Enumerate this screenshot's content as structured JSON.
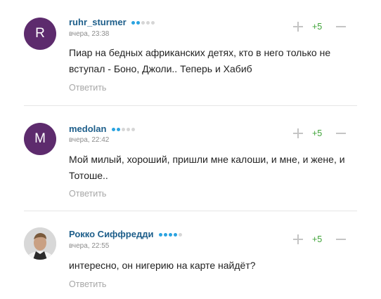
{
  "comments": [
    {
      "avatar_letter": "R",
      "avatar_color": "#5d2b6d",
      "username": "ruhr_sturmer",
      "rating_dots": 2,
      "time": "вчера, 23:38",
      "text": "Пиар на бедных африканских детях, кто в него только не вступал - Боно, Джоли.. Теперь и Хабиб",
      "score": "+5",
      "reply_label": "Ответить"
    },
    {
      "avatar_letter": "M",
      "avatar_color": "#5d2b6d",
      "username": "medolan",
      "rating_dots": 2,
      "time": "вчера, 22:42",
      "text": "Мой милый, хороший, пришли мне калоши, и мне, и жене, и Тотоше..",
      "score": "+5",
      "reply_label": "Ответить"
    },
    {
      "avatar_letter": "",
      "avatar_color": "#d9d9d9",
      "username": "Рокко Сиффредди",
      "rating_dots": 4,
      "time": "вчера, 22:55",
      "text": "интересно, он нигерию на карте найдёт?",
      "score": "+5",
      "reply_label": "Ответить"
    }
  ],
  "colors": {
    "username": "#1d5e8a",
    "dot_active": "#2aa3e0",
    "dot_inactive": "#d6d6d6",
    "score_positive": "#3ea337"
  }
}
